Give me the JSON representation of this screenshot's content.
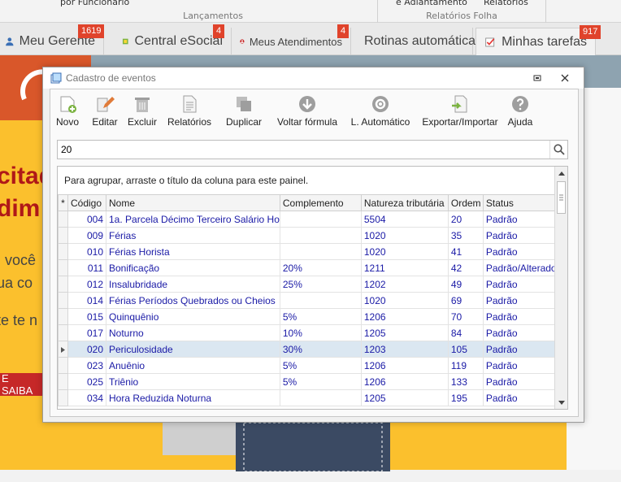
{
  "ribbon": {
    "cut1": "por Funcionário",
    "cut2": "e Adiantamento",
    "cut3": "Relatórios",
    "group1": "Lançamentos",
    "group2": "Relatórios Folha"
  },
  "tabs": [
    {
      "label": "Meu Gerente",
      "badge": "1619"
    },
    {
      "label": "Central eSocial",
      "badge": "4"
    },
    {
      "label": "Meus Atendimentos",
      "badge": "4"
    },
    {
      "label": "Rotinas automáticas",
      "badge": ""
    },
    {
      "label": "Minhas tarefas",
      "badge": "917"
    }
  ],
  "background": {
    "line1": "citad",
    "line2": "dim",
    "line3": ", você",
    "line4": "ua co",
    "line5": "te te n",
    "saiba": "E SAIBA"
  },
  "dialog": {
    "title": "Cadastro de eventos",
    "toolbar": [
      "Novo",
      "Editar",
      "Excluir",
      "Relatórios",
      "Duplicar",
      "Voltar fórmula",
      "L. Automático",
      "Exportar/Importar",
      "Ajuda"
    ],
    "search_value": "20",
    "group_hint": "Para agrupar, arraste o título da coluna para este painel.",
    "columns": [
      "Código",
      "Nome",
      "Complemento",
      "Natureza tributária",
      "Ordem",
      "Status"
    ],
    "rows": [
      [
        "004",
        "1a. Parcela Décimo Terceiro Salário Ho",
        "",
        "5504",
        "20",
        "Padrão"
      ],
      [
        "009",
        "Férias",
        "",
        "1020",
        "35",
        "Padrão"
      ],
      [
        "010",
        "Férias Horista",
        "",
        "1020",
        "41",
        "Padrão"
      ],
      [
        "011",
        "Bonificação",
        "20%",
        "1211",
        "42",
        "Padrão/Alterado"
      ],
      [
        "012",
        "Insalubridade",
        "25%",
        "1202",
        "49",
        "Padrão"
      ],
      [
        "014",
        "Férias Períodos Quebrados ou Cheios",
        "",
        "1020",
        "69",
        "Padrão"
      ],
      [
        "015",
        "Quinquênio",
        "5%",
        "1206",
        "70",
        "Padrão"
      ],
      [
        "017",
        "Noturno",
        "10%",
        "1205",
        "84",
        "Padrão"
      ],
      [
        "020",
        "Periculosidade",
        "30%",
        "1203",
        "105",
        "Padrão"
      ],
      [
        "023",
        "Anuênio",
        "5%",
        "1206",
        "119",
        "Padrão"
      ],
      [
        "025",
        "Triênio",
        "5%",
        "1206",
        "133",
        "Padrão"
      ],
      [
        "034",
        "Hora Reduzida Noturna",
        "",
        "1205",
        "195",
        "Padrão"
      ]
    ],
    "selected_index": 8
  }
}
